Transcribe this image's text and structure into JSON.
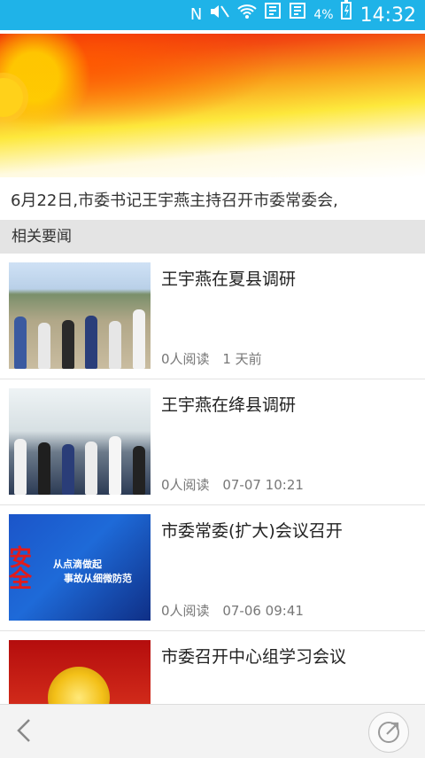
{
  "status_bar": {
    "battery": "4%",
    "time": "14:32",
    "icons": [
      "nfc-icon",
      "mute-icon",
      "wifi-icon",
      "sim1-icon",
      "sim2-icon",
      "battery-charging-icon"
    ]
  },
  "article": {
    "summary": "6月22日,市委书记王宇燕主持召开市委常委会,"
  },
  "related": {
    "header": "相关要闻",
    "items": [
      {
        "title": "王宇燕在夏县调研",
        "reads": "0人阅读",
        "time": "1 天前"
      },
      {
        "title": "王宇燕在绛县调研",
        "reads": "0人阅读",
        "time": "07-07 10:21"
      },
      {
        "title": "市委常委(扩大)会议召开",
        "reads": "0人阅读",
        "time": "07-06 09:41",
        "thumb_text_1": "从点滴做起",
        "thumb_text_2": "事故从细微防范",
        "thumb_text_3": "安全"
      },
      {
        "title": "市委召开中心组学习会议",
        "reads": "",
        "time": ""
      }
    ]
  },
  "bottom_bar": {
    "icons": [
      "back-icon",
      "share-icon"
    ]
  }
}
